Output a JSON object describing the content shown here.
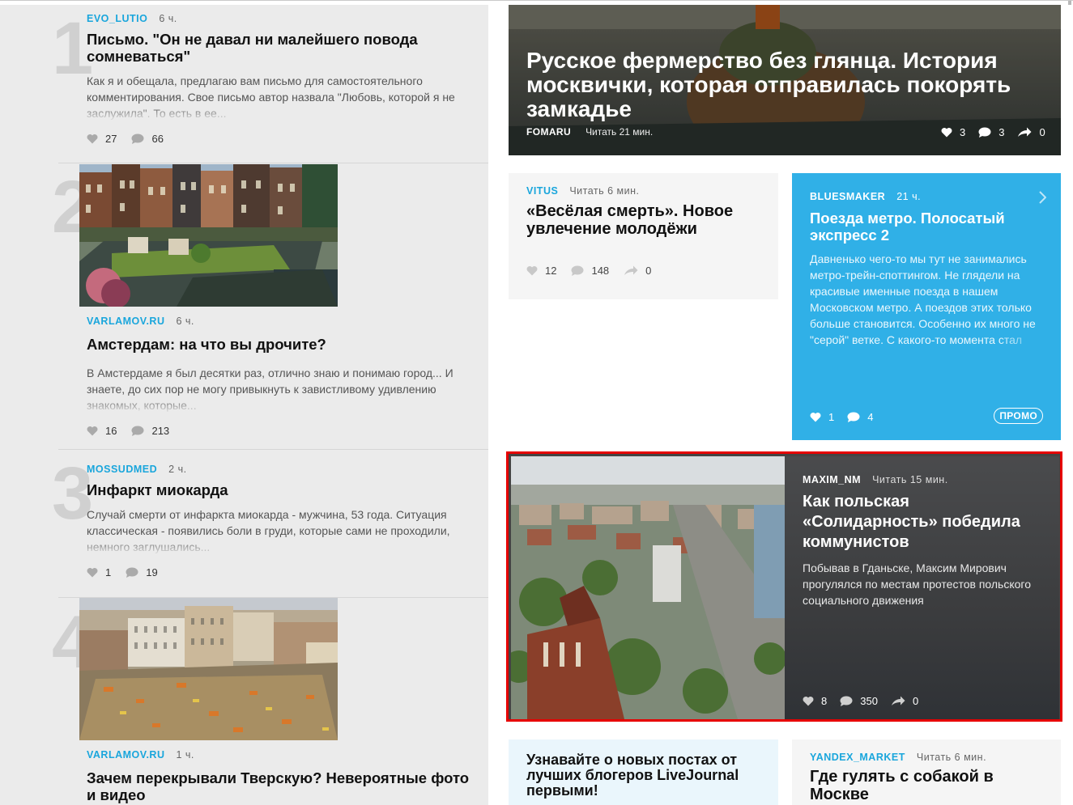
{
  "left_feed": [
    {
      "rank": "1",
      "author": "EVO_LUTIO",
      "time": "6 ч.",
      "title": "Письмо. \"Он не давал ни малейшего повода сомневаться\"",
      "description": "Как я и обещала, предлагаю вам письмо для самостоятельного комментирования. Свое письмо автор назвала \"Любовь, которой я не заслужила\". То есть в ее...",
      "likes": "27",
      "comments": "66"
    },
    {
      "rank": "2",
      "author": "VARLAMOV.RU",
      "time": "6 ч.",
      "title": "Амстердам: на что вы дрочите?",
      "description": "В Амстердаме я был десятки раз, отлично знаю и понимаю город... И знаете, до сих пор не могу привыкнуть к завистливому удивлению знакомых, которые...",
      "likes": "16",
      "comments": "213",
      "image": "amsterdam-canal-photo"
    },
    {
      "rank": "3",
      "author": "MOSSUDMED",
      "time": "2 ч.",
      "title": "Инфаркт миокарда",
      "description": "Случай смерти от инфаркта миокарда - мужчина, 53 года. Ситуация классическая - появились боли в груди, которые сами не проходили, немного заглушались...",
      "likes": "1",
      "comments": "19"
    },
    {
      "rank": "4",
      "author": "VARLAMOV.RU",
      "time": "1 ч.",
      "title": "Зачем перекрывали Тверскую? Невероятные фото и видео",
      "image": "tverskaya-construction-photo"
    }
  ],
  "hero": {
    "title": "Русское фермерство без глянца. История москвички, которая отправилась покорять замкадье",
    "author": "FOMARU",
    "read_time": "Читать 21 мин.",
    "likes": "3",
    "comments": "3",
    "shares": "0"
  },
  "card_vitus": {
    "author": "VITUS",
    "read_time": "Читать 6 мин.",
    "title": "«Весёлая смерть». Новое увлечение молодёжи",
    "likes": "12",
    "comments": "148",
    "shares": "0"
  },
  "promo": {
    "author": "BLUESMAKER",
    "time": "21 ч.",
    "title": "Поезда метро. Полосатый экспресс 2",
    "description": "Давненько чего-то мы тут не занимались метро-трейн-споттингом. Не глядели на красивые именные поезда в нашем Московском метро. А поездов этих только больше становится. Особенно их много не \"серой\" ветке. С какого-то момента стал каждый ден",
    "likes": "1",
    "comments": "4",
    "badge": "ПРОМО"
  },
  "featured": {
    "author": "MAXIM_NM",
    "read_time": "Читать 15 мин.",
    "title": "Как польская «Солидарность» победила коммунистов",
    "description": "Побывав в Гданьске, Максим Мирович прогулялся по местам протестов польского социального движения",
    "likes": "8",
    "comments": "350",
    "shares": "0",
    "image": "gdansk-aerial-photo"
  },
  "subscribe": {
    "text": "Узнавайте о новых постах от лучших блогеров LiveJournal первыми!"
  },
  "card_market": {
    "author": "YANDEX_MARKET",
    "read_time": "Читать 6 мин.",
    "title": "Где гулять с собакой в Москве"
  },
  "colors": {
    "accent": "#1aa6dc",
    "promo_bg": "#30b0e7",
    "highlight_border": "#e60000"
  }
}
